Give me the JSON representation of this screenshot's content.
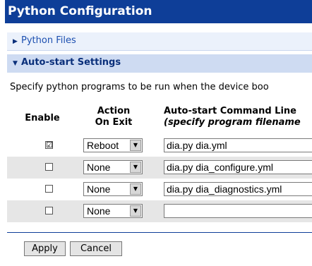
{
  "title": "Python Configuration",
  "sections": {
    "python_files": {
      "label": "Python Files",
      "expanded": false
    },
    "autostart": {
      "label": "Auto-start Settings",
      "expanded": true
    }
  },
  "description": "Specify python programs to be run when the device boo",
  "table": {
    "headers": {
      "enable": "Enable",
      "action_line1": "Action",
      "action_line2": "On Exit",
      "cmd_line1": "Auto-start Command Line",
      "cmd_line2": "(specify program filename"
    },
    "rows": [
      {
        "enabled": true,
        "check": "☑",
        "action": "Reboot",
        "command": "dia.py dia.yml"
      },
      {
        "enabled": false,
        "check": "",
        "action": "None",
        "command": "dia.py dia_configure.yml"
      },
      {
        "enabled": false,
        "check": "",
        "action": "None",
        "command": "dia.py dia_diagnostics.yml"
      },
      {
        "enabled": false,
        "check": "",
        "action": "None",
        "command": ""
      }
    ]
  },
  "buttons": {
    "apply": "Apply",
    "cancel": "Cancel"
  },
  "colors": {
    "title_bg": "#0e3e98",
    "section_bg": "#cedbf2",
    "row_shade": "#e6e6e6"
  }
}
